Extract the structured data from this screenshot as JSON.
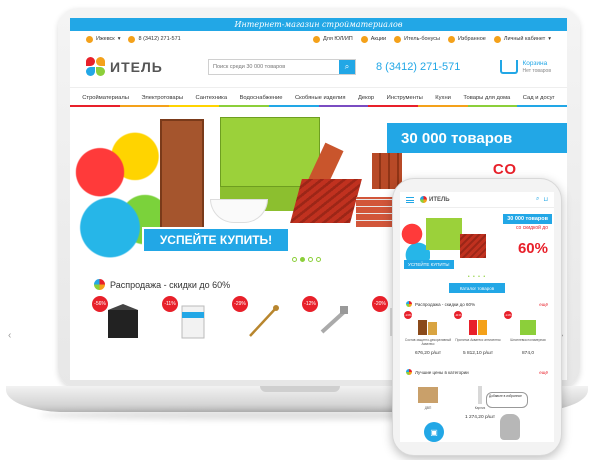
{
  "site": {
    "tagline": "Интернет-магазин стройматериалов",
    "city": "Ижевск",
    "city_phone": "8 (3412) 271-571",
    "links": [
      "Для ЮЛ/ИП",
      "Акции",
      "Итель-бонусы",
      "Избранное",
      "Личный кабинет"
    ],
    "logo": "ИТЕЛЬ",
    "search_placeholder": "Поиск среди 30 000 товаров",
    "phone": "8 (3412) 271-571",
    "cart_title": "Корзина",
    "cart_sub": "Нет товаров"
  },
  "nav": [
    "Стройматериалы",
    "Электротовары",
    "Сантехника",
    "Водоснабжение",
    "Скобяные изделия",
    "Декор",
    "Инструменты",
    "Кухни",
    "Товары для дома",
    "Сад и досуг"
  ],
  "nav_colors": [
    "#e8202a",
    "#f4a11a",
    "#ffd400",
    "#8ccf3a",
    "#22a7e6",
    "#7a4cc2",
    "#e8202a",
    "#f4a11a",
    "#8ccf3a",
    "#22a7e6"
  ],
  "banner": {
    "count": "30 000 товаров",
    "sale": "СО",
    "cta": "УСПЕЙТЕ КУПИТЬ!"
  },
  "sale_section": {
    "title": "Распродажа - скидки до 60%",
    "badges": [
      "-56%",
      "-11%",
      "-29%",
      "-12%",
      "-20%"
    ]
  },
  "mobile": {
    "logo": "ИТЕЛЬ",
    "count": "30 000 товаров",
    "sale_line1": "со скидкой до",
    "sale_big": "60%",
    "cta": "УСПЕЙТЕ КУПИТЬ!",
    "catalog_button": "Каталог товаров",
    "sale_title": "Распродажа - скидки до 60%",
    "all_link": "ещё",
    "products": [
      {
        "badge": "-13%",
        "name": "Состав защитно-декоративный Акватекс",
        "price": "676,20 р/шт"
      },
      {
        "badge": "-11%",
        "name": "Пропитка Акватекс антисептик",
        "price": "5 812,10 р/шт"
      },
      {
        "badge": "-14%",
        "name": "Шпатлевка полимерная",
        "price": "874,0"
      }
    ],
    "best_title": "Лучшие цены в категории",
    "best_items": [
      {
        "name": "ДВП",
        "price": ""
      },
      {
        "name": "Карниз",
        "price": "1 274,20 р/шт"
      }
    ],
    "bubble": "Добавьте в избранное"
  },
  "colors": {
    "brand_blue": "#22a7e6",
    "sale_red": "#e8202a",
    "accent_orange": "#f4a11a",
    "accent_green": "#8ccf3a"
  }
}
